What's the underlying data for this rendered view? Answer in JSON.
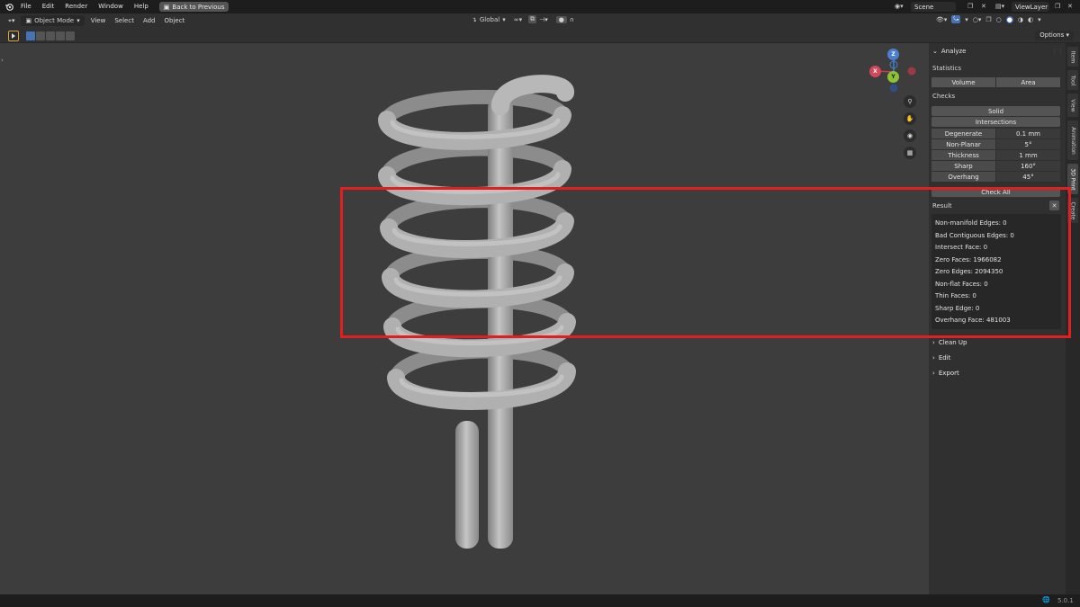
{
  "menu": [
    "File",
    "Edit",
    "Render",
    "Window",
    "Help"
  ],
  "back_button": "Back to Previous",
  "scene": "Scene",
  "view_layer": "ViewLayer",
  "header": {
    "mode": "Object Mode",
    "items": [
      "View",
      "Select",
      "Add",
      "Object"
    ],
    "orientation": "Global"
  },
  "options_label": "Options",
  "gizmo": {
    "x": "X",
    "y": "Y",
    "z": "Z"
  },
  "panel": {
    "title": "Analyze",
    "statistics_label": "Statistics",
    "volume": "Volume",
    "area": "Area",
    "checks_label": "Checks",
    "solid": "Solid",
    "intersections": "Intersections",
    "checks": [
      {
        "name": "Degenerate",
        "value": "0.1 mm"
      },
      {
        "name": "Non-Planar",
        "value": "5°"
      },
      {
        "name": "Thickness",
        "value": "1 mm"
      },
      {
        "name": "Sharp",
        "value": "160°"
      },
      {
        "name": "Overhang",
        "value": "45°"
      }
    ],
    "check_all": "Check All",
    "result_label": "Result",
    "results": [
      "Non-manifold Edges: 0",
      "Bad Contiguous Edges: 0",
      "Intersect Face: 0",
      "Zero Faces: 1966082",
      "Zero Edges: 2094350",
      "Non-flat Faces: 0",
      "Thin Faces: 0",
      "Sharp Edge: 0",
      "Overhang Face: 481003"
    ],
    "collapsed": [
      "Clean Up",
      "Edit",
      "Export"
    ]
  },
  "tabs": [
    "Item",
    "Tool",
    "View",
    "Animation",
    "3D Print",
    "Create"
  ],
  "version": "5.0.1",
  "colors": {
    "highlight": "#e02020",
    "accent": "#4772b3"
  }
}
